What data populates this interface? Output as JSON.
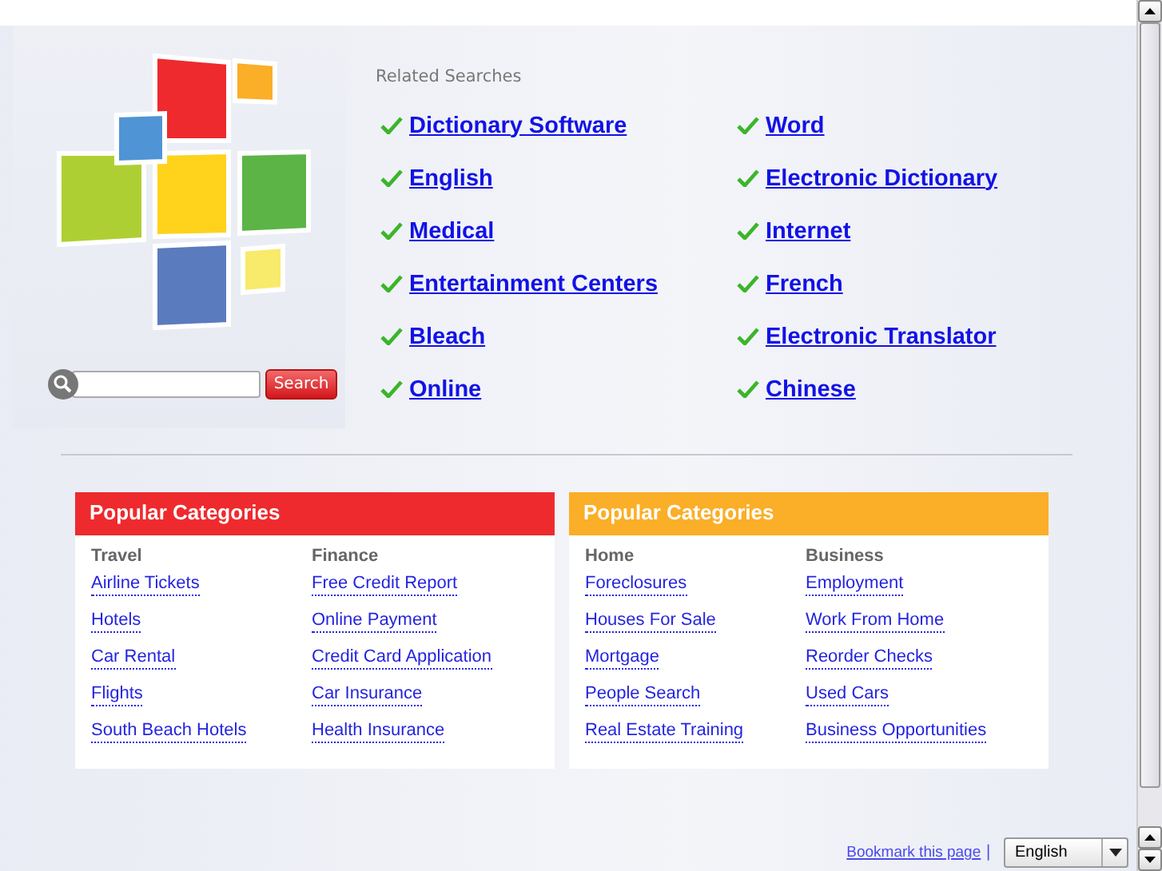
{
  "search": {
    "button": "Search"
  },
  "related": {
    "title": "Related Searches",
    "columns": [
      {
        "links": [
          "Dictionary Software",
          "English",
          "Medical",
          "Entertainment Centers",
          "Bleach",
          "Online"
        ]
      },
      {
        "links": [
          "Word",
          "Electronic Dictionary",
          "Internet",
          "French",
          "Electronic Translator",
          "Chinese"
        ]
      }
    ]
  },
  "categories": [
    {
      "title": "Popular Categories",
      "color": "#ee2a2e",
      "groups": [
        {
          "heading": "Travel",
          "links": [
            "Airline Tickets",
            "Hotels",
            "Car Rental",
            "Flights",
            "South Beach Hotels"
          ]
        },
        {
          "heading": "Finance",
          "links": [
            "Free Credit Report",
            "Online Payment",
            "Credit Card Application",
            "Car Insurance",
            "Health Insurance"
          ]
        }
      ]
    },
    {
      "title": "Popular Categories",
      "color": "#fbae27",
      "groups": [
        {
          "heading": "Home",
          "links": [
            "Foreclosures",
            "Houses For Sale",
            "Mortgage",
            "People Search",
            "Real Estate Training"
          ]
        },
        {
          "heading": "Business",
          "links": [
            "Employment",
            "Work From Home",
            "Reorder Checks",
            "Used Cars",
            "Business Opportunities"
          ]
        }
      ]
    }
  ],
  "footer": {
    "bookmark": "Bookmark this page",
    "separator": "|",
    "language": "English"
  }
}
